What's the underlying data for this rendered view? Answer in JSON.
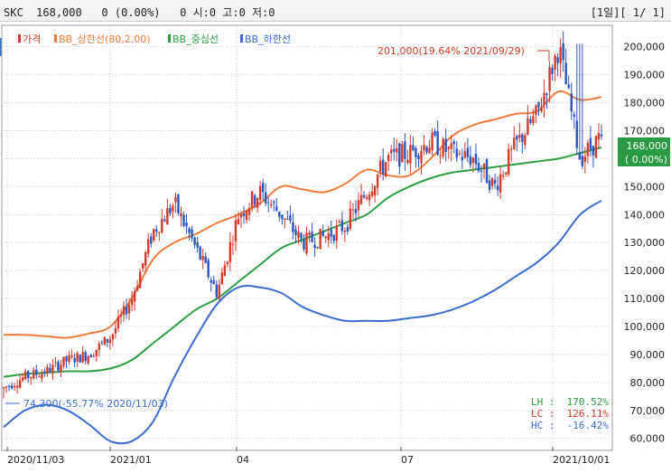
{
  "header": {
    "stock_name": "SKC",
    "price": "168,000",
    "change": "0 (0.00%)",
    "volume": "0",
    "ohlc_text": "시:0 고:0 저:0",
    "pager": "[1일][ 1/ 1]",
    "menu_arrow": "▼"
  },
  "side_button": "호",
  "legend": [
    {
      "label": "가격",
      "color": "#d43a2a"
    },
    {
      "label": "BB_상한선(80,2.00)",
      "color": "#f07a3a"
    },
    {
      "label": "BB_중심선",
      "color": "#2aa040"
    },
    {
      "label": "BB_하한선",
      "color": "#3a6cd0"
    }
  ],
  "annotations": {
    "high": "201,000(19.64% 2021/09/29)",
    "low": "74,300(-55.77% 2020/11/03)"
  },
  "current_price": {
    "price": "168,000",
    "change": "( 0.00%)"
  },
  "stats": [
    {
      "label": "LH :",
      "value": "170.52%",
      "color": "#2aa040"
    },
    {
      "label": "LC :",
      "value": "126.11%",
      "color": "#d43a2a"
    },
    {
      "label": "HC :",
      "value": "-16.42%",
      "color": "#3a6cd0"
    }
  ],
  "chart_data": {
    "type": "candlestick",
    "y_ticks": [
      "200,000",
      "190,000",
      "180,000",
      "170,000",
      "160,000",
      "150,000",
      "140,000",
      "130,000",
      "120,000",
      "110,000",
      "100,000",
      "90,000",
      "80,000",
      "70,000",
      "60,000"
    ],
    "x_ticks": [
      "2020/11/03",
      "2021/01",
      "04",
      "07",
      "2021/10/01"
    ],
    "ylim": [
      57000,
      207000
    ],
    "high_point": {
      "date": "2021/09/29",
      "value": 201000
    },
    "low_point": {
      "date": "2020/11/03",
      "value": 74300
    },
    "last_price": 168000,
    "upper_band": [
      97000,
      97000,
      96500,
      96000,
      97500,
      100000,
      110000,
      124000,
      130000,
      133000,
      137000,
      140000,
      144000,
      150000,
      149000,
      148000,
      151000,
      156000,
      154000,
      154000,
      160000,
      168000,
      172000,
      174000,
      176000,
      177000,
      184000,
      181000,
      182000
    ],
    "middle_band": [
      82000,
      83000,
      83500,
      84000,
      84000,
      85000,
      88000,
      94000,
      100000,
      106000,
      110000,
      116000,
      122000,
      128000,
      131000,
      134000,
      137000,
      140000,
      146000,
      150000,
      153000,
      155000,
      156000,
      157000,
      158000,
      159000,
      160000,
      162000,
      164000
    ],
    "lower_band": [
      64000,
      70000,
      72000,
      70000,
      65000,
      59000,
      59000,
      66000,
      82000,
      96000,
      108000,
      114000,
      114000,
      112000,
      107000,
      104000,
      102000,
      102000,
      102000,
      103000,
      104000,
      106000,
      109000,
      113000,
      118000,
      123000,
      130000,
      140000,
      145000
    ],
    "close_series": [
      78000,
      82000,
      84000,
      88000,
      90000,
      96000,
      110000,
      134000,
      144000,
      128000,
      112000,
      140000,
      148000,
      140000,
      130000,
      132000,
      136000,
      148000,
      160000,
      162000,
      166000,
      162000,
      160000,
      150000,
      165000,
      176000,
      200000,
      160000,
      168000
    ]
  }
}
